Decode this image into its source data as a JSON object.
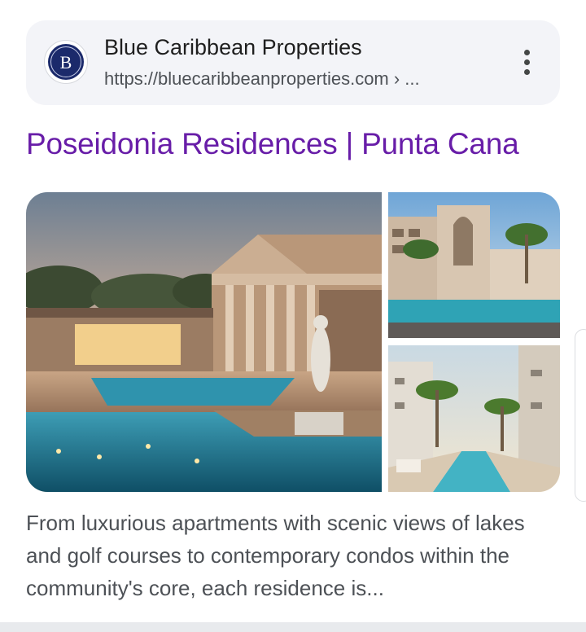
{
  "source": {
    "site_name": "Blue Caribbean Properties",
    "url": "https://bluecaribbeanproperties.com › ...",
    "favicon_letter": "B",
    "favicon_icon": "brand-logo-icon",
    "more_icon": "more-vert-icon"
  },
  "result": {
    "title": "Poseidonia Residences | Punta Cana",
    "snippet": "From luxurious apartments with scenic views of lakes and golf courses to contemporary condos within the community's core, each residence is..."
  },
  "images": [
    {
      "name": "main-resort-pool-image"
    },
    {
      "name": "courtyard-pool-image"
    },
    {
      "name": "lazy-river-pool-image"
    }
  ],
  "colors": {
    "title_link": "#681da8",
    "card_background": "#f3f4f8",
    "logo_navy": "#1b2a6b",
    "snippet_text": "#4d5156"
  }
}
